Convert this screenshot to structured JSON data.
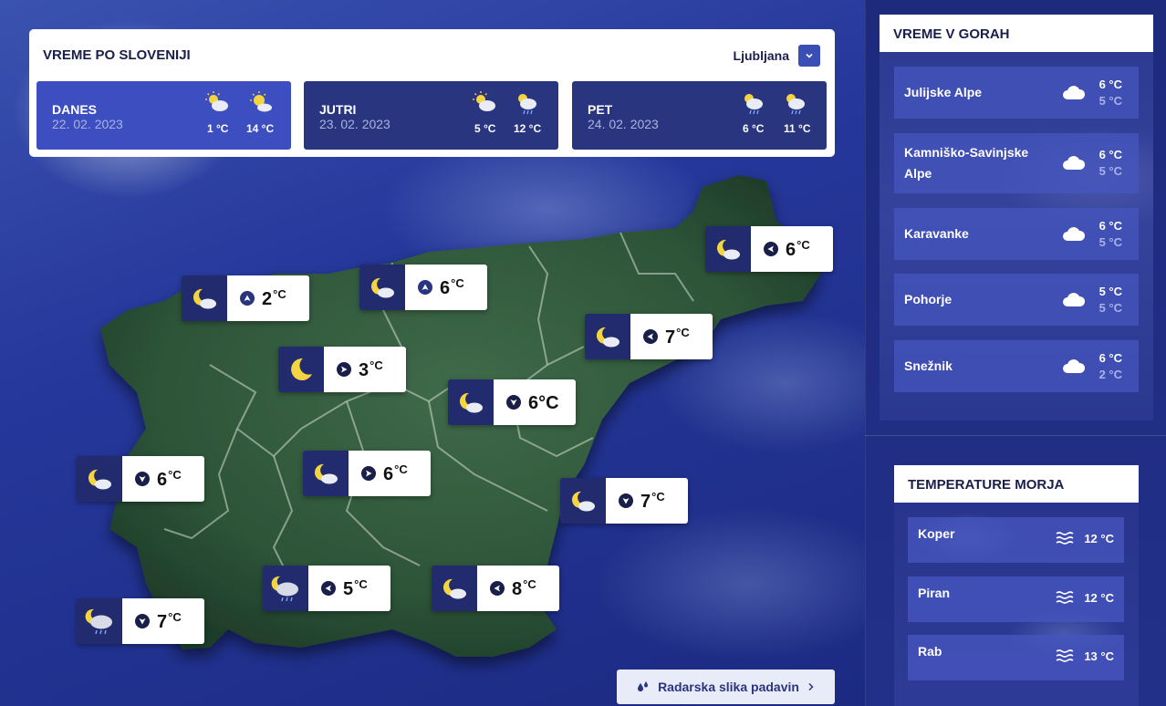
{
  "forecast": {
    "title": "VREME PO SLOVENIJI",
    "city": "Ljubljana",
    "days": [
      {
        "name": "DANES",
        "date": "22. 02. 2023",
        "t_min": "1 °C",
        "t_max": "14 °C",
        "active": true
      },
      {
        "name": "JUTRI",
        "date": "23. 02. 2023",
        "t_min": "5 °C",
        "t_max": "12 °C",
        "active": false
      },
      {
        "name": "PET",
        "date": "24. 02. 2023",
        "t_min": "6 °C",
        "t_max": "11 °C",
        "active": false
      }
    ]
  },
  "map": {
    "labels": [
      {
        "temp": "2",
        "unit": "°C",
        "icon": "moon-cloud-icon",
        "wind": "wind-up-icon"
      },
      {
        "temp": "6",
        "unit": "°C",
        "icon": "moon-cloud-icon",
        "wind": "wind-up-icon"
      },
      {
        "temp": "6",
        "unit": "°C",
        "icon": "moon-cloud-icon",
        "wind": "wind-left-icon"
      },
      {
        "temp": "7",
        "unit": "°C",
        "icon": "moon-cloud-icon",
        "wind": "wind-left-icon"
      },
      {
        "temp": "3",
        "unit": "°C",
        "icon": "moon-icon",
        "wind": "wind-right-icon"
      },
      {
        "temp": "6°C",
        "unit": "",
        "icon": "moon-cloud-icon",
        "wind": "wind-down-icon"
      },
      {
        "temp": "6",
        "unit": "°C",
        "icon": "moon-cloud-icon",
        "wind": "wind-down-icon"
      },
      {
        "temp": "6",
        "unit": "°C",
        "icon": "moon-cloud-icon",
        "wind": "wind-right-icon"
      },
      {
        "temp": "7",
        "unit": "°C",
        "icon": "moon-cloud-icon",
        "wind": "wind-down-icon"
      },
      {
        "temp": "5",
        "unit": "°C",
        "icon": "moon-rain-cloud-icon",
        "wind": "wind-left-icon"
      },
      {
        "temp": "8",
        "unit": "°C",
        "icon": "moon-cloud-icon",
        "wind": "wind-left-icon"
      },
      {
        "temp": "7",
        "unit": "°C",
        "icon": "moon-rain-cloud-icon",
        "wind": "wind-down-icon"
      }
    ],
    "radar_button": "Radarska slika padavin"
  },
  "mountains": {
    "title": "VREME V GORAH",
    "items": [
      {
        "name": "Julijske Alpe",
        "t_high": "6 °C",
        "t_low": "5 °C"
      },
      {
        "name": "Kamniško-Savinjske Alpe",
        "t_high": "6 °C",
        "t_low": "5 °C"
      },
      {
        "name": "Karavanke",
        "t_high": "6 °C",
        "t_low": "5 °C"
      },
      {
        "name": "Pohorje",
        "t_high": "5 °C",
        "t_low": "5 °C"
      },
      {
        "name": "Snežnik",
        "t_high": "6 °C",
        "t_low": "2 °C"
      }
    ]
  },
  "sea": {
    "title": "TEMPERATURE MORJA",
    "items": [
      {
        "name": "Koper",
        "temp": "12 °C"
      },
      {
        "name": "Piran",
        "temp": "12 °C"
      },
      {
        "name": "Rab",
        "temp": "13 °C"
      }
    ]
  }
}
